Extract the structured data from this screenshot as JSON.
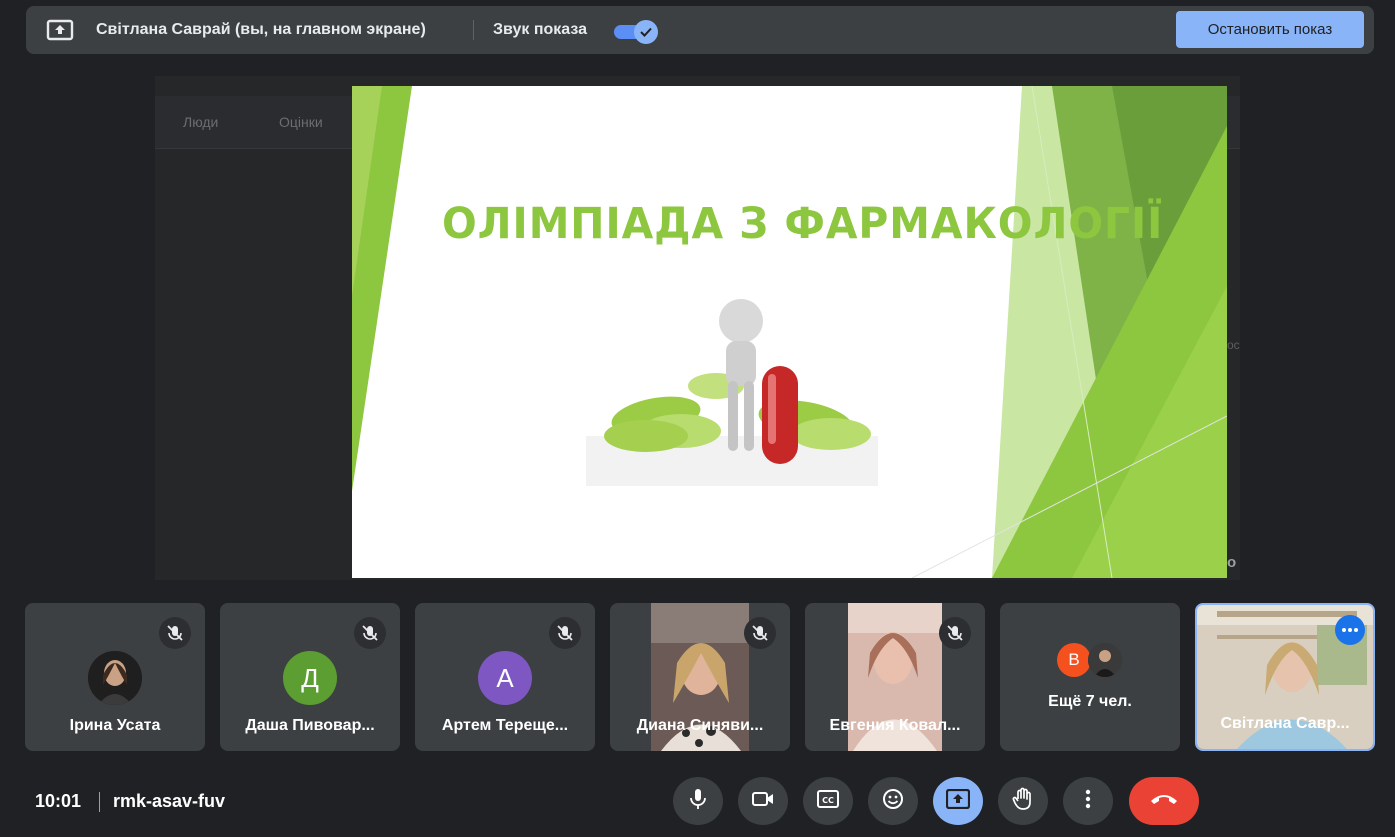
{
  "top_bar": {
    "presenter": "Світлана Саврай (вы, на главном экране)",
    "sound_label": "Звук показа",
    "sound_enabled": true,
    "stop_button": "Остановить показ"
  },
  "background_page": {
    "tabs": [
      "Люди",
      "Оцінки"
    ],
    "fragments": [
      "ос",
      "о"
    ]
  },
  "slide": {
    "title": "ОЛІМПІАДА З ФАРМАКОЛОГІЇ",
    "accent_color": "#8dc63f"
  },
  "participants": [
    {
      "name": "Ірина Усата",
      "type": "photo-avatar",
      "muted": true
    },
    {
      "name": "Даша Пивовар...",
      "type": "letter",
      "initial": "Д",
      "color": "#5c9e31",
      "muted": true
    },
    {
      "name": "Артем Терещe...",
      "type": "letter",
      "initial": "А",
      "color": "#7e57c2",
      "muted": true
    },
    {
      "name": "Диана Синяви...",
      "type": "video",
      "muted": true
    },
    {
      "name": "Евгения Ковал...",
      "type": "video",
      "muted": true
    },
    {
      "name": "Ещё 7 чел.",
      "type": "more",
      "initial": "В",
      "color": "#f4511e"
    },
    {
      "name": "Світлана Савр...",
      "type": "self-video"
    }
  ],
  "bottom_bar": {
    "time": "10:01",
    "meeting_code": "rmk-asav-fuv"
  },
  "controls": [
    "mic-icon",
    "camera-icon",
    "captions-icon",
    "emoji-icon",
    "present-icon",
    "hand-icon",
    "more-icon",
    "end-call-icon"
  ]
}
